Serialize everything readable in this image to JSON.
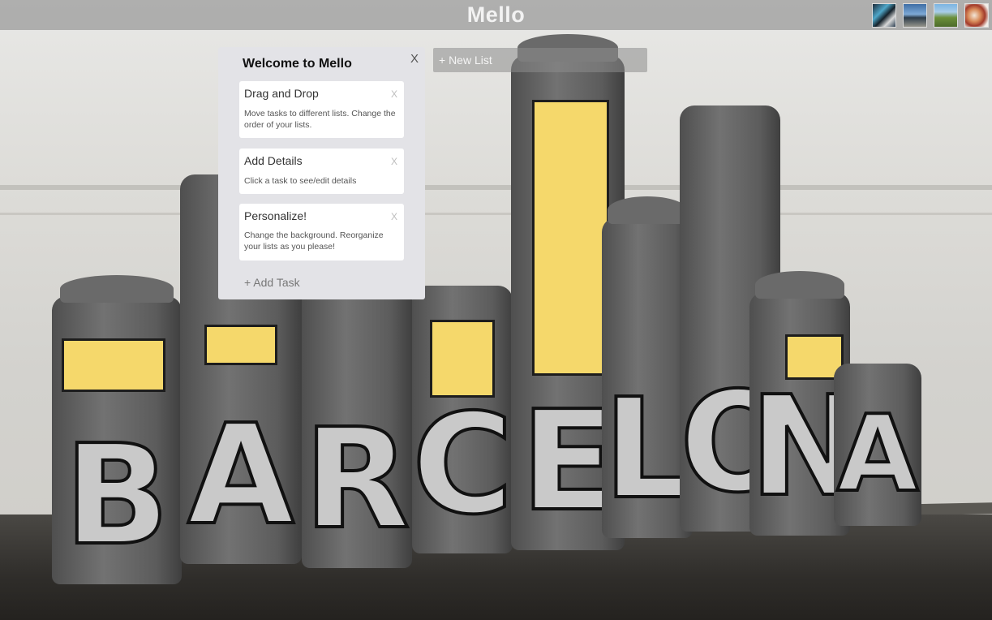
{
  "header": {
    "title": "Mello",
    "background_thumbnails": [
      {
        "name": "graffiti-thumbnail"
      },
      {
        "name": "pier-thumbnail"
      },
      {
        "name": "landscape-thumbnail"
      },
      {
        "name": "food-thumbnail"
      }
    ]
  },
  "list": {
    "title": "Welcome to Mello",
    "close_label": "X",
    "cards": [
      {
        "title": "Drag and Drop",
        "remove_label": "X",
        "description": "Move tasks to different lists. Change the order of your lists."
      },
      {
        "title": "Add Details",
        "remove_label": "X",
        "description": "Click a task to see/edit details"
      },
      {
        "title": "Personalize!",
        "remove_label": "X",
        "description": "Change the background. Reorganize your lists as you please!"
      }
    ],
    "add_task_label": "+ Add Task"
  },
  "new_list_label": "+ New List",
  "background": {
    "letters": [
      "B",
      "A",
      "R",
      "C",
      "E",
      "L",
      "O",
      "N",
      "A"
    ],
    "accent_window_color": "#f5d86b"
  }
}
